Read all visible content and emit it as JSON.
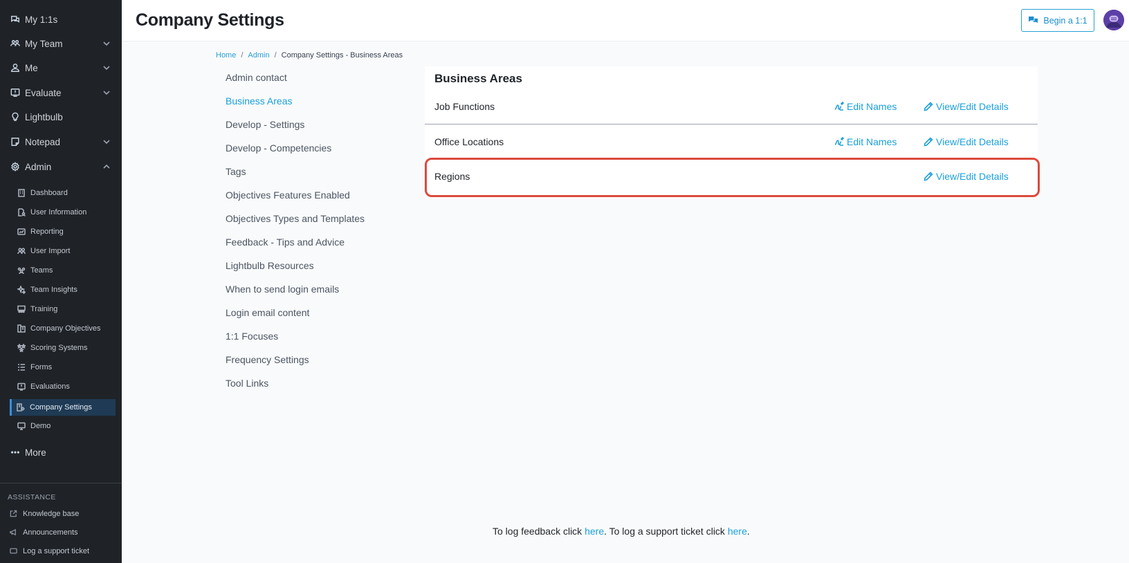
{
  "sidebar": {
    "items": [
      {
        "label": "My 1:1s",
        "icon": "chat-icon"
      },
      {
        "label": "My Team",
        "icon": "team-icon"
      },
      {
        "label": "Me",
        "icon": "user-icon"
      },
      {
        "label": "Evaluate",
        "icon": "evaluate-icon"
      },
      {
        "label": "Lightbulb",
        "icon": "lightbulb-icon"
      },
      {
        "label": "Notepad",
        "icon": "notepad-icon"
      },
      {
        "label": "Admin",
        "icon": "gear-icon"
      }
    ],
    "admin_items": [
      {
        "label": "Dashboard"
      },
      {
        "label": "User Information"
      },
      {
        "label": "Reporting"
      },
      {
        "label": "User Import"
      },
      {
        "label": "Teams"
      },
      {
        "label": "Team Insights"
      },
      {
        "label": "Training"
      },
      {
        "label": "Company Objectives"
      },
      {
        "label": "Scoring Systems"
      },
      {
        "label": "Forms"
      },
      {
        "label": "Evaluations"
      },
      {
        "label": "Company Settings"
      },
      {
        "label": "Demo"
      }
    ],
    "more_label": "More",
    "assistance": {
      "title": "ASSISTANCE",
      "items": [
        {
          "label": "Knowledge base"
        },
        {
          "label": "Announcements"
        },
        {
          "label": "Log a support ticket"
        }
      ]
    }
  },
  "header": {
    "title": "Company Settings",
    "begin_label": "Begin a 1:1"
  },
  "breadcrumb": {
    "home": "Home",
    "admin": "Admin",
    "current": "Company Settings - Business Areas",
    "sep": "/"
  },
  "settings_menu": [
    "Admin contact",
    "Business Areas",
    "Develop - Settings",
    "Develop - Competencies",
    "Tags",
    "Objectives Features Enabled",
    "Objectives Types and Templates",
    "Feedback - Tips and Advice",
    "Lightbulb Resources",
    "When to send login emails",
    "Login email content",
    "1:1 Focuses",
    "Frequency Settings",
    "Tool Links"
  ],
  "business_areas": {
    "title": "Business Areas",
    "rows": [
      {
        "label": "Job Functions",
        "edit_names": "Edit Names",
        "view_edit": "View/Edit Details"
      },
      {
        "label": "Office Locations",
        "edit_names": "Edit Names",
        "view_edit": "View/Edit Details"
      },
      {
        "label": "Regions",
        "view_edit": "View/Edit Details"
      }
    ]
  },
  "footer": {
    "part1": "To log feedback click ",
    "link1": "here",
    "part2": ". To log a support ticket click ",
    "link2": "here",
    "part3": "."
  },
  "colors": {
    "accent": "#1aa0dc",
    "sidebar_bg": "#1f2328",
    "highlight": "#dc4a3d",
    "active_item_bg": "#1f3a54"
  }
}
